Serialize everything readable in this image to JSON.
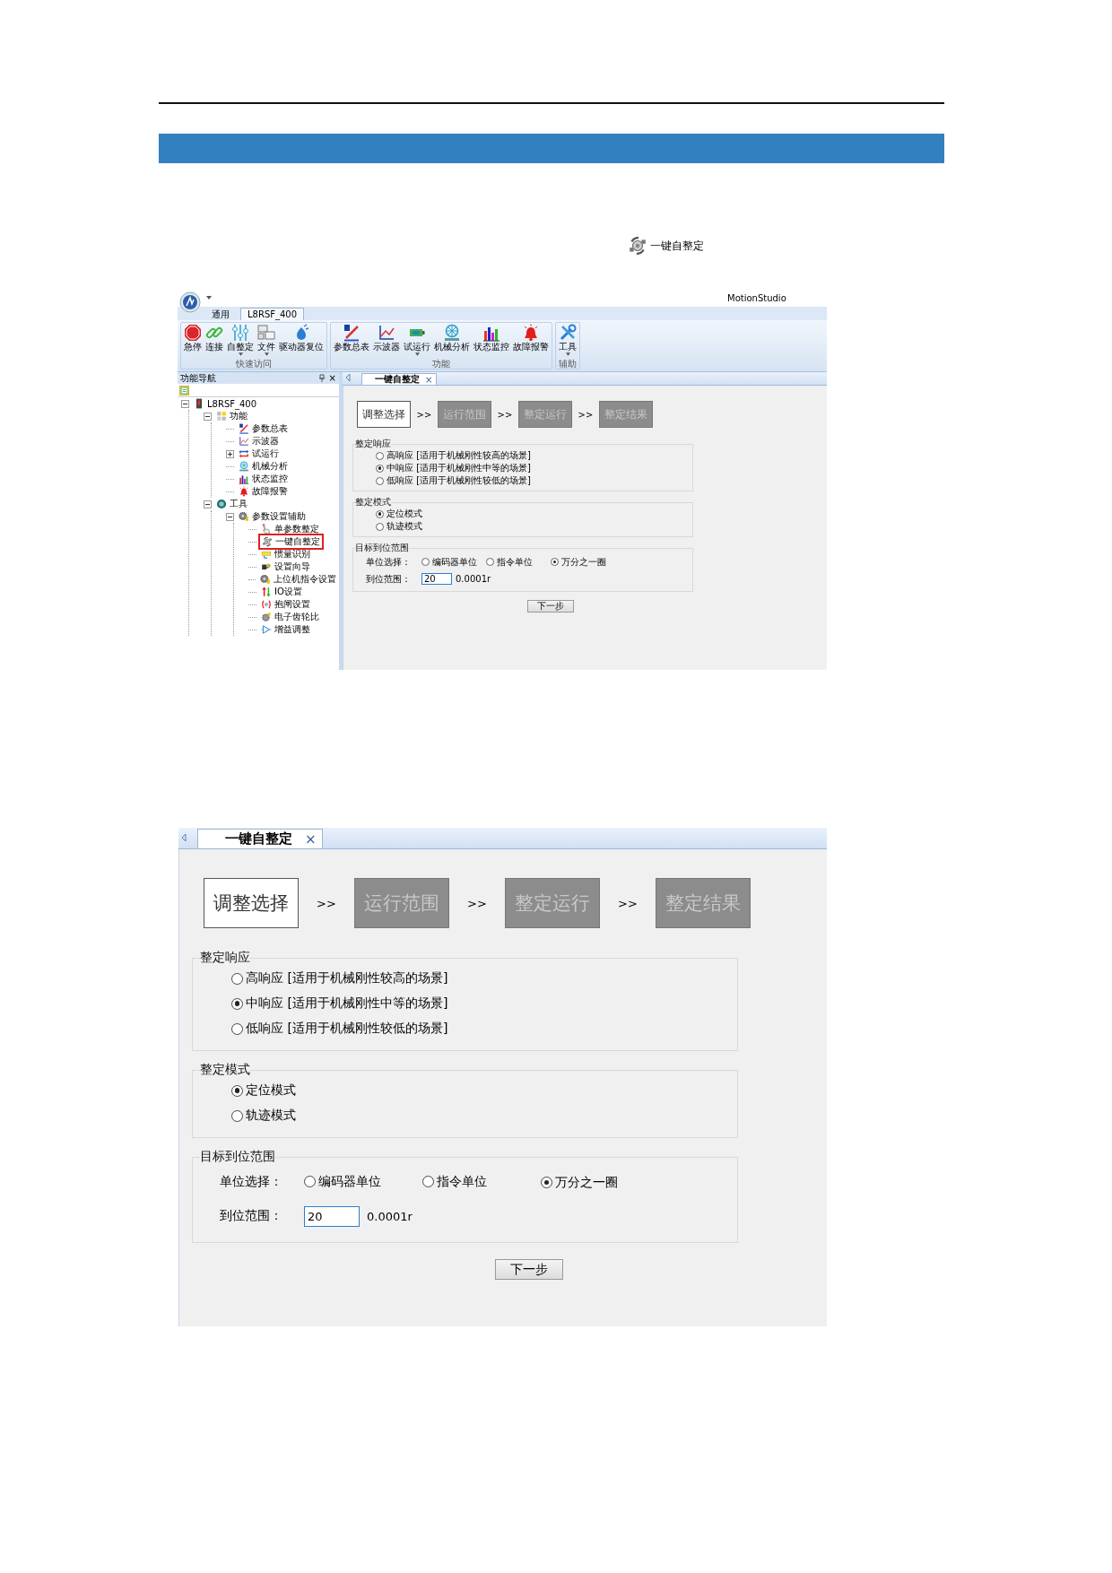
{
  "intro_line": {
    "label": "一键自整定"
  },
  "app_window": {
    "title": "MotionStudio",
    "ribbon_tabs": [
      {
        "label": "通用",
        "selected": false
      },
      {
        "label": "L8RSF_400",
        "selected": true
      }
    ],
    "ribbon_groups": [
      {
        "label": "快速访问",
        "buttons": [
          {
            "label": "急停",
            "dropdown": false
          },
          {
            "label": "连接",
            "dropdown": false
          },
          {
            "label": "自整定",
            "dropdown": true
          },
          {
            "label": "文件",
            "dropdown": true
          },
          {
            "label": "驱动器复位",
            "dropdown": false
          }
        ]
      },
      {
        "label": "功能",
        "buttons": [
          {
            "label": "参数总表",
            "dropdown": false
          },
          {
            "label": "示波器",
            "dropdown": false
          },
          {
            "label": "试运行",
            "dropdown": true
          },
          {
            "label": "机械分析",
            "dropdown": false
          },
          {
            "label": "状态监控",
            "dropdown": false
          },
          {
            "label": "故障报警",
            "dropdown": false
          }
        ]
      },
      {
        "label": "辅助",
        "buttons": [
          {
            "label": "工具",
            "dropdown": true
          }
        ]
      }
    ],
    "nav_pane": {
      "title": "功能导航",
      "close": "×",
      "tree": [
        {
          "label": "L8RSF_400",
          "selected": false,
          "expanded": true,
          "children": [
            {
              "label": "功能",
              "selected": false,
              "expanded": true,
              "children": [
                {
                  "label": "参数总表",
                  "selected": false
                },
                {
                  "label": "示波器",
                  "selected": false
                },
                {
                  "label": "试运行",
                  "selected": false,
                  "expanded": false
                },
                {
                  "label": "机械分析",
                  "selected": false
                },
                {
                  "label": "状态监控",
                  "selected": false
                },
                {
                  "label": "故障报警",
                  "selected": false
                }
              ]
            },
            {
              "label": "工具",
              "selected": false,
              "expanded": true,
              "children": [
                {
                  "label": "参数设置辅助",
                  "selected": false,
                  "expanded": true,
                  "children": [
                    {
                      "label": "单参数整定",
                      "selected": false
                    },
                    {
                      "label": "一键自整定",
                      "selected": true
                    },
                    {
                      "label": "惯量识别",
                      "selected": false
                    },
                    {
                      "label": "设置向导",
                      "selected": false
                    },
                    {
                      "label": "上位机指令设置",
                      "selected": false
                    },
                    {
                      "label": "IO设置",
                      "selected": false
                    },
                    {
                      "label": "抱闸设置",
                      "selected": false
                    },
                    {
                      "label": "电子齿轮比",
                      "selected": false
                    },
                    {
                      "label": "增益调整",
                      "selected": false
                    }
                  ]
                }
              ]
            }
          ]
        }
      ]
    },
    "document": {
      "tab": {
        "label": "一键自整定",
        "close": "×"
      },
      "steps": [
        {
          "label": "调整选择",
          "selected": true
        },
        {
          "label": "运行范围",
          "selected": false
        },
        {
          "label": "整定运行",
          "selected": false
        },
        {
          "label": "整定结果",
          "selected": false
        }
      ],
      "separators": [
        ">>",
        ">>",
        ">>"
      ],
      "response": {
        "title": "整定响应",
        "options": [
          {
            "label": "高响应 [适用于机械刚性较高的场景]",
            "selected": false
          },
          {
            "label": "中响应 [适用于机械刚性中等的场景]",
            "selected": true
          },
          {
            "label": "低响应 [适用于机械刚性较低的场景]",
            "selected": false
          }
        ]
      },
      "mode": {
        "title": "整定模式",
        "options": [
          {
            "label": "定位模式",
            "selected": true
          },
          {
            "label": "轨迹模式",
            "selected": false
          }
        ]
      },
      "target": {
        "title": "目标到位范围",
        "unit_label": "单位选择：",
        "unit_options": [
          {
            "label": "编码器单位",
            "selected": false
          },
          {
            "label": "指令单位",
            "selected": false
          },
          {
            "label": "万分之一圈",
            "selected": true
          }
        ],
        "range_label": "到位范围：",
        "range_value": "20",
        "range_unit": "0.0001r"
      },
      "next_button": "下一步"
    }
  },
  "detail_view": {
    "tab": {
      "label": "一键自整定",
      "close": "×"
    },
    "steps": [
      {
        "label": "调整选择",
        "selected": true
      },
      {
        "label": "运行范围",
        "selected": false
      },
      {
        "label": "整定运行",
        "selected": false
      },
      {
        "label": "整定结果",
        "selected": false
      }
    ],
    "separators": [
      ">>",
      ">>",
      ">>"
    ],
    "response": {
      "title": "整定响应",
      "options": [
        {
          "label": "高响应 [适用于机械刚性较高的场景]",
          "selected": false
        },
        {
          "label": "中响应 [适用于机械刚性中等的场景]",
          "selected": true
        },
        {
          "label": "低响应 [适用于机械刚性较低的场景]",
          "selected": false
        }
      ]
    },
    "mode": {
      "title": "整定模式",
      "options": [
        {
          "label": "定位模式",
          "selected": true
        },
        {
          "label": "轨迹模式",
          "selected": false
        }
      ]
    },
    "target": {
      "title": "目标到位范围",
      "unit_label": "单位选择：",
      "unit_options": [
        {
          "label": "编码器单位",
          "selected": false
        },
        {
          "label": "指令单位",
          "selected": false
        },
        {
          "label": "万分之一圈",
          "selected": true
        }
      ],
      "range_label": "到位范围：",
      "range_value": "20",
      "range_unit": "0.0001r"
    },
    "next_button": "下一步"
  }
}
